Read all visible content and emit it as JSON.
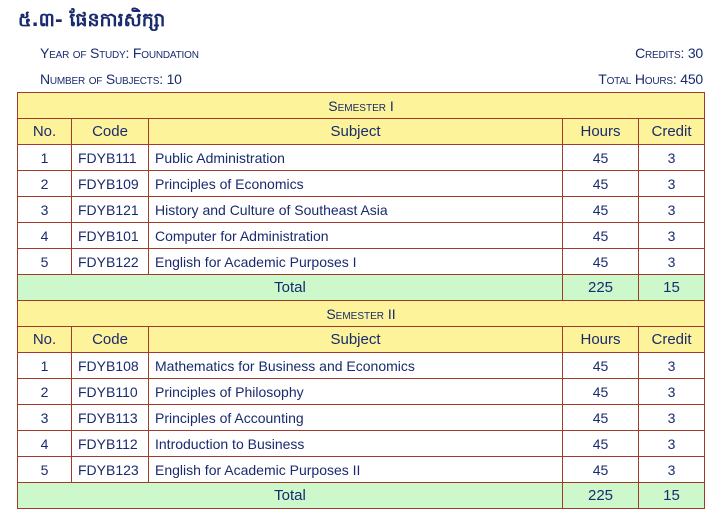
{
  "heading": "៥.៣- ផែនការសិក្សា",
  "meta": {
    "year_of_study": "Year of Study: Foundation",
    "credits": "Credits: 30",
    "number_of_subjects": "Number of Subjects: 10",
    "total_hours": "Total Hours: 450"
  },
  "columns": [
    "No.",
    "Code",
    "Subject",
    "Hours",
    "Credit"
  ],
  "semesters": [
    {
      "title": "Semester I",
      "rows": [
        {
          "no": "1",
          "code": "FDYB111",
          "subject": "Public Administration",
          "hours": "45",
          "credit": "3"
        },
        {
          "no": "2",
          "code": "FDYB109",
          "subject": "Principles of Economics",
          "hours": "45",
          "credit": "3"
        },
        {
          "no": "3",
          "code": "FDYB121",
          "subject": "History and Culture of Southeast Asia",
          "hours": "45",
          "credit": "3"
        },
        {
          "no": "4",
          "code": "FDYB101",
          "subject": "Computer for Administration",
          "hours": "45",
          "credit": "3"
        },
        {
          "no": "5",
          "code": "FDYB122",
          "subject": "English for Academic Purposes I",
          "hours": "45",
          "credit": "3"
        }
      ],
      "total_label": "Total",
      "total_hours": "225",
      "total_credit": "15"
    },
    {
      "title": "Semester II",
      "rows": [
        {
          "no": "1",
          "code": "FDYB108",
          "subject": "Mathematics for Business and Economics",
          "hours": "45",
          "credit": "3"
        },
        {
          "no": "2",
          "code": "FDYB110",
          "subject": "Principles of Philosophy",
          "hours": "45",
          "credit": "3"
        },
        {
          "no": "3",
          "code": "FDYB113",
          "subject": "Principles of Accounting",
          "hours": "45",
          "credit": "3"
        },
        {
          "no": "4",
          "code": "FDYB112",
          "subject": "Introduction to Business",
          "hours": "45",
          "credit": "3"
        },
        {
          "no": "5",
          "code": "FDYB123",
          "subject": "English for Academic Purposes II",
          "hours": "45",
          "credit": "3"
        }
      ],
      "total_label": "Total",
      "total_hours": "225",
      "total_credit": "15"
    }
  ],
  "colors": {
    "text": "#1a2a6e",
    "header_bg": "#fcf39a",
    "total_bg": "#ccf8cc",
    "border": "#a23a2a"
  }
}
